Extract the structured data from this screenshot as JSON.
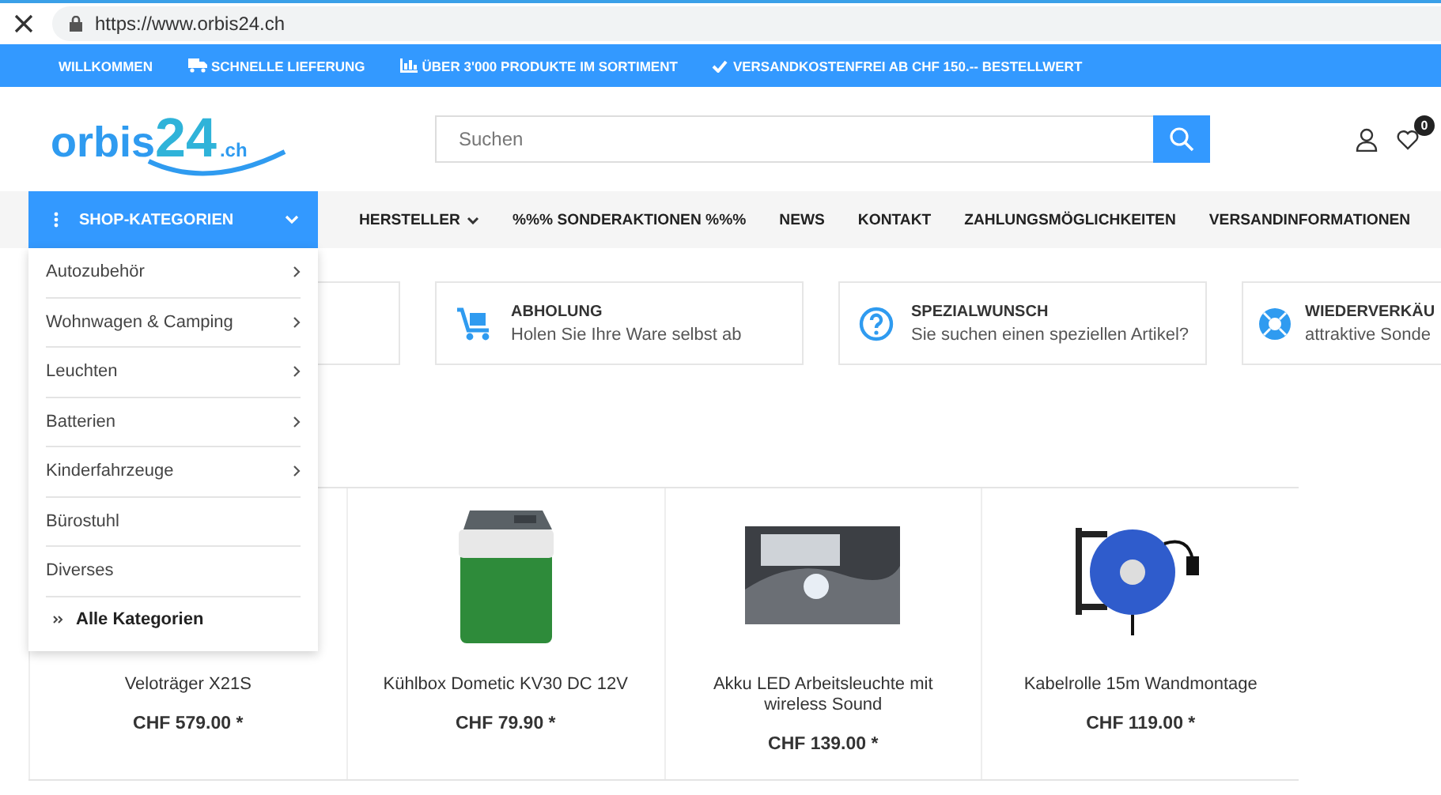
{
  "browser": {
    "url": "https://www.orbis24.ch"
  },
  "top_bar": [
    {
      "kind": "text",
      "label": "WILLKOMMEN"
    },
    {
      "kind": "truck",
      "label": "SCHNELLE LIEFERUNG"
    },
    {
      "kind": "chart",
      "label": "ÜBER 3'000 PRODUKTE IM SORTIMENT"
    },
    {
      "kind": "check",
      "label": "VERSANDKOSTENFREI AB CHF 150.-- BESTELLWERT"
    }
  ],
  "header": {
    "logo": {
      "main": "orbis",
      "number": "24",
      "suffix": ".ch"
    },
    "search": {
      "placeholder": "Suchen"
    },
    "wishlist_count": "0"
  },
  "nav": {
    "categories_button": "SHOP-KATEGORIEN",
    "items": [
      {
        "label": "HERSTELLER",
        "dropdown": true
      },
      {
        "label": "%%% SONDERAKTIONEN %%%",
        "dropdown": false
      },
      {
        "label": "NEWS",
        "dropdown": false
      },
      {
        "label": "KONTAKT",
        "dropdown": false
      },
      {
        "label": "ZAHLUNGSMÖGLICHKEITEN",
        "dropdown": false
      },
      {
        "label": "VERSANDINFORMATIONEN",
        "dropdown": false
      }
    ]
  },
  "category_menu": {
    "expanded": true,
    "items": [
      {
        "label": "Autozubehör",
        "has_children": true
      },
      {
        "label": "Wohnwagen & Camping",
        "has_children": true
      },
      {
        "label": "Leuchten",
        "has_children": true
      },
      {
        "label": "Batterien",
        "has_children": true
      },
      {
        "label": "Kinderfahrzeuge",
        "has_children": true
      },
      {
        "label": "Bürostuhl",
        "has_children": false
      },
      {
        "label": "Diverses",
        "has_children": false
      }
    ],
    "all_link": "Alle Kategorien"
  },
  "features": [
    {
      "kind": "hidden"
    },
    {
      "kind": "cart",
      "title": "ABHOLUNG",
      "text": "Holen Sie Ihre Ware selbst ab"
    },
    {
      "kind": "question",
      "title": "SPEZIALWUNSCH",
      "text": "Sie suchen einen speziellen Artikel?"
    },
    {
      "kind": "lifebuoy",
      "title": "WIEDERVERKÄU",
      "text": "attraktive Sonde"
    }
  ],
  "products": [
    {
      "name": "Veloträger X21S",
      "price": "CHF 579.00 *"
    },
    {
      "kind": "cooler",
      "name": "Kühlbox Dometic KV30 DC 12V",
      "price": "CHF 79.90 *"
    },
    {
      "kind": "photo",
      "name": "Akku LED Arbeitsleuchte mit wireless Sound",
      "price": "CHF 139.00 *"
    },
    {
      "kind": "reel",
      "name": "Kabelrolle 15m Wandmontage",
      "price": "CHF 119.00 *"
    }
  ]
}
